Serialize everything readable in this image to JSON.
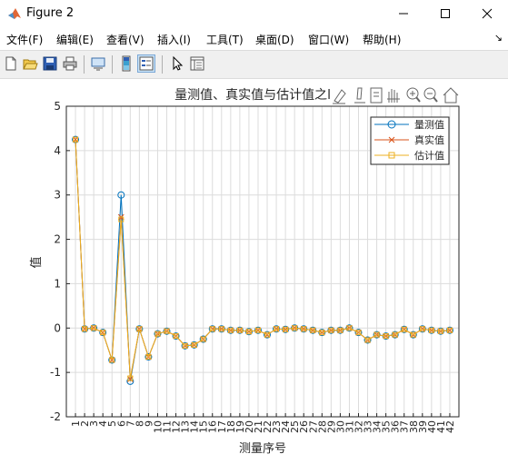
{
  "window": {
    "title": "Figure 2"
  },
  "menu": [
    "文件(F)",
    "编辑(E)",
    "查看(V)",
    "插入(I)",
    "工具(T)",
    "桌面(D)",
    "窗口(W)",
    "帮助(H)"
  ],
  "menu_overflow": "↘",
  "toolbar": [
    "new-figure-icon",
    "open-file-icon",
    "save-icon",
    "print-icon",
    "link-plot-icon",
    "colorbar-icon",
    "legend-icon",
    "pointer-icon",
    "property-inspector-icon"
  ],
  "axes_toolbar": [
    "brush-icon",
    "data-tips-icon",
    "restore-view-icon",
    "pan-icon",
    "zoom-in-icon",
    "zoom-out-icon",
    "home-icon"
  ],
  "colors": {
    "measured": "#0072bd",
    "true": "#d95319",
    "estimate": "#edb120",
    "grid": "#dcdcdc"
  },
  "chart_data": {
    "type": "line",
    "title": "量测值、真实值与估计值之l",
    "xlabel": "测量序号",
    "ylabel": "值",
    "xlim": [
      0,
      43
    ],
    "ylim": [
      -2,
      5
    ],
    "yticks": [
      -2,
      -1,
      0,
      1,
      2,
      3,
      4,
      5
    ],
    "x": [
      1,
      2,
      3,
      4,
      5,
      6,
      7,
      8,
      9,
      10,
      11,
      12,
      13,
      14,
      15,
      16,
      17,
      18,
      19,
      20,
      21,
      22,
      23,
      24,
      25,
      26,
      27,
      28,
      29,
      30,
      31,
      32,
      33,
      34,
      35,
      36,
      37,
      38,
      39,
      40,
      41,
      42
    ],
    "grid": true,
    "legend_position": "top-right",
    "series": [
      {
        "name": "量测值",
        "marker": "o",
        "color": "#0072bd",
        "values": [
          4.25,
          -0.02,
          0.0,
          -0.1,
          -0.72,
          3.0,
          -1.2,
          -0.02,
          -0.65,
          -0.13,
          -0.07,
          -0.18,
          -0.4,
          -0.38,
          -0.25,
          -0.02,
          -0.02,
          -0.05,
          -0.05,
          -0.08,
          -0.05,
          -0.15,
          -0.02,
          -0.03,
          0.0,
          -0.02,
          -0.05,
          -0.1,
          -0.05,
          -0.05,
          0.0,
          -0.1,
          -0.27,
          -0.15,
          -0.18,
          -0.15,
          -0.03,
          -0.15,
          -0.02,
          -0.05,
          -0.07,
          -0.05
        ]
      },
      {
        "name": "真实值",
        "marker": "x",
        "color": "#d95319",
        "values": [
          4.25,
          -0.02,
          0.0,
          -0.1,
          -0.72,
          2.5,
          -1.15,
          -0.02,
          -0.65,
          -0.13,
          -0.07,
          -0.18,
          -0.4,
          -0.38,
          -0.25,
          -0.02,
          -0.02,
          -0.05,
          -0.05,
          -0.08,
          -0.05,
          -0.15,
          -0.02,
          -0.03,
          0.0,
          -0.02,
          -0.05,
          -0.1,
          -0.05,
          -0.05,
          0.0,
          -0.1,
          -0.27,
          -0.15,
          -0.18,
          -0.15,
          -0.03,
          -0.15,
          -0.02,
          -0.05,
          -0.07,
          -0.05
        ]
      },
      {
        "name": "估计值",
        "marker": "s",
        "color": "#edb120",
        "values": [
          4.25,
          -0.02,
          0.0,
          -0.1,
          -0.72,
          2.45,
          -1.13,
          -0.02,
          -0.65,
          -0.13,
          -0.07,
          -0.18,
          -0.4,
          -0.38,
          -0.25,
          -0.02,
          -0.02,
          -0.05,
          -0.05,
          -0.08,
          -0.05,
          -0.15,
          -0.02,
          -0.03,
          0.0,
          -0.02,
          -0.05,
          -0.1,
          -0.05,
          -0.05,
          0.0,
          -0.1,
          -0.27,
          -0.15,
          -0.18,
          -0.15,
          -0.03,
          -0.15,
          -0.02,
          -0.05,
          -0.07,
          -0.05
        ]
      }
    ]
  }
}
